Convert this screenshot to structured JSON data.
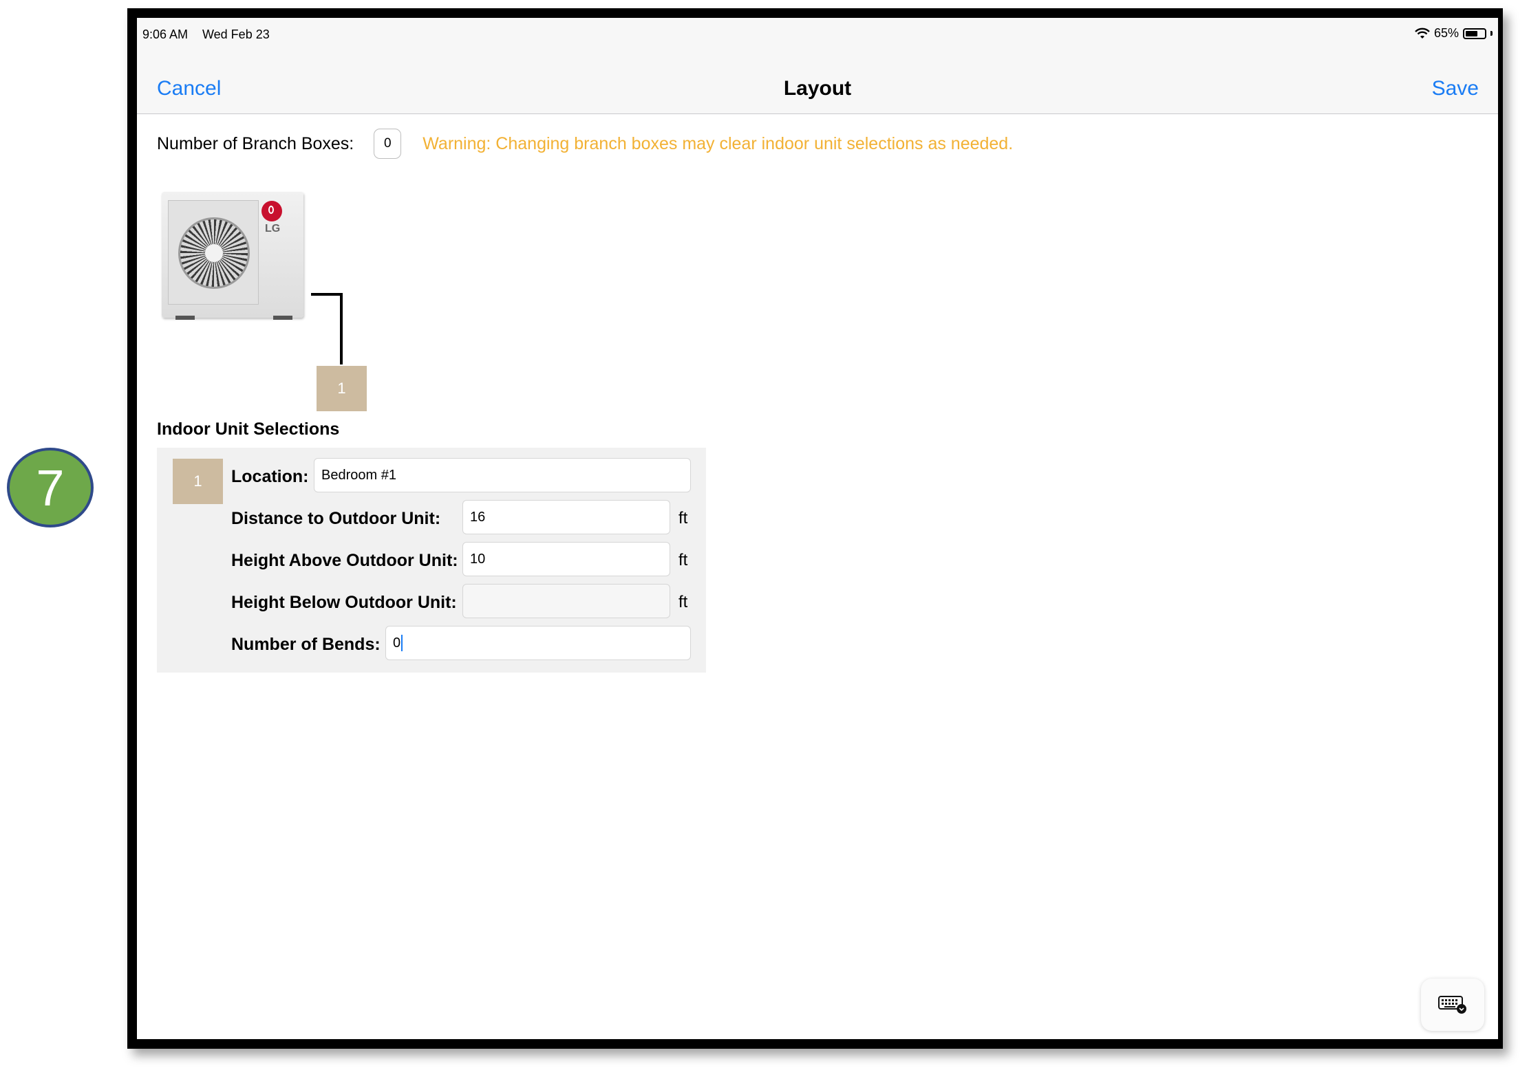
{
  "step_badge": {
    "number": "7"
  },
  "status_bar": {
    "time": "9:06 AM",
    "date": "Wed Feb 23",
    "battery_percent": "65%",
    "battery_level": 0.65
  },
  "nav": {
    "cancel_label": "Cancel",
    "title": "Layout",
    "save_label": "Save"
  },
  "branch": {
    "label": "Number of Branch Boxes:",
    "value": "0",
    "warning": "Warning: Changing branch boxes may clear indoor unit selections as needed."
  },
  "diagram": {
    "outdoor_unit": {
      "brand": "LG",
      "icon": "outdoor-unit-image"
    },
    "indoor_unit_box": "1"
  },
  "indoor_units": {
    "heading": "Indoor Unit Selections",
    "unit": {
      "number": "1",
      "location_label": "Location:",
      "location_value": "Bedroom #1",
      "distance_label": "Distance to Outdoor Unit:",
      "distance_value": "16",
      "height_above_label": "Height Above Outdoor Unit:",
      "height_above_value": "10",
      "height_below_label": "Height Below Outdoor Unit:",
      "height_below_value": "",
      "bends_label": "Number of Bends:",
      "bends_value": "0",
      "unit_suffix": "ft"
    }
  },
  "keyboard_button": {
    "icon": "keyboard-dismiss-icon"
  },
  "colors": {
    "link": "#1a7cf4",
    "warning": "#f2b134",
    "unit_box": "#cdbba0",
    "badge": "#6ea84a"
  }
}
